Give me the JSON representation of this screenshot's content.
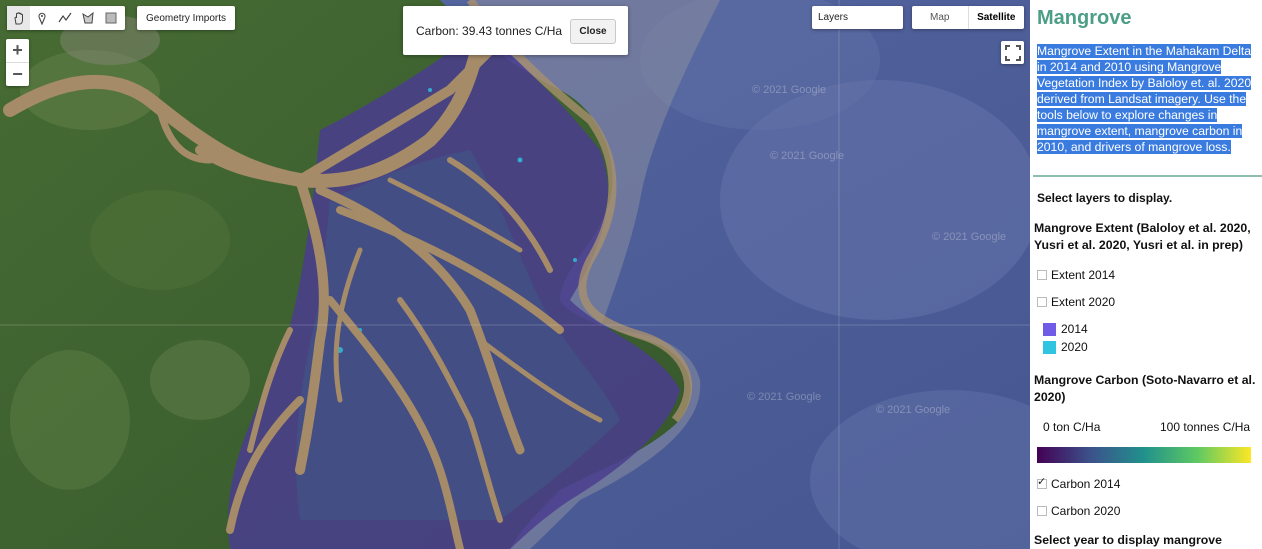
{
  "map": {
    "geometry_imports_label": "Geometry Imports",
    "zoom_in_label": "+",
    "zoom_out_label": "−",
    "popup": {
      "text": "Carbon: 39.43 tonnes C/Ha",
      "close_label": "Close"
    },
    "layers_label": "Layers",
    "maptype": {
      "map_label": "Map",
      "satellite_label": "Satellite",
      "selected": "Satellite"
    },
    "watermark": "© 2021 Google",
    "tools": [
      "hand-icon",
      "marker-icon",
      "polyline-icon",
      "polygon-icon",
      "rectangle-icon"
    ]
  },
  "panel": {
    "title": "Mangrove",
    "description": "Mangrove Extent in the Mahakam Delta in 2014 and 2010 using Mangrove Vegetation Index by Baloloy et. al. 2020 derived from Landsat imagery. Use the tools below to explore changes in mangrove extent, mangrove carbon in 2010, and drivers of mangrove loss.",
    "select_layers_label": "Select layers to display.",
    "extent_heading": "Mangrove Extent (Baloloy et al. 2020, Yusri et al. 2020, Yusri et al. in prep)",
    "extent_2014_label": "Extent 2014",
    "extent_2020_label": "Extent 2020",
    "legend": [
      {
        "label": "2014",
        "color": "#6f5be6"
      },
      {
        "label": "2020",
        "color": "#2fc4e0"
      }
    ],
    "carbon_heading": "Mangrove Carbon (Soto-Navarro et al. 2020)",
    "colorbar_min_label": "0 ton C/Ha",
    "colorbar_max_label": "100 tonnes C/Ha",
    "carbon_2014_label": "Carbon 2014",
    "carbon_2014_checked": true,
    "carbon_2020_label": "Carbon 2020",
    "carbon_2020_checked": false,
    "select_year_label": "Select year to display mangrove",
    "accent_color": "#4d9e86",
    "selection_color": "#3a7be0"
  }
}
